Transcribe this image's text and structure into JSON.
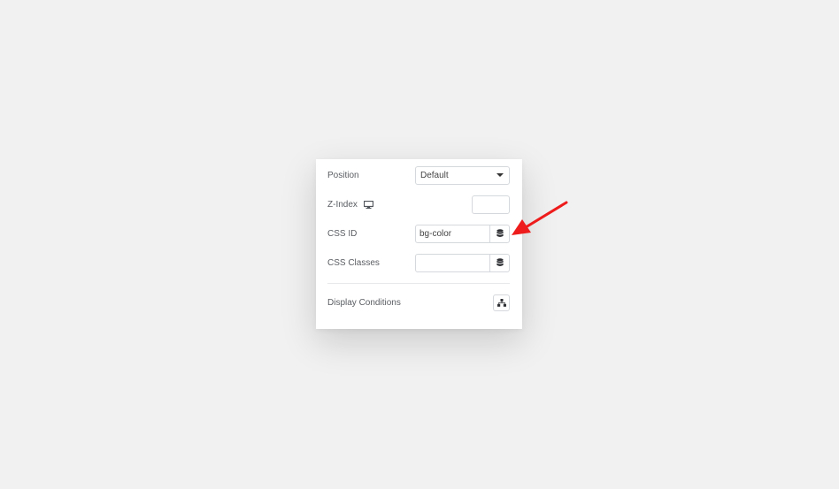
{
  "panel": {
    "position": {
      "label": "Position",
      "selected": "Default"
    },
    "zindex": {
      "label": "Z-Index",
      "value": ""
    },
    "css_id": {
      "label": "CSS ID",
      "value": "bg-color"
    },
    "css_classes": {
      "label": "CSS Classes",
      "value": ""
    },
    "display_conditions": {
      "label": "Display Conditions"
    }
  },
  "icons": {
    "desktop": "desktop-icon",
    "dynamic_tags": "database-icon",
    "conditions": "sitemap-icon",
    "annotation": "red-arrow"
  },
  "colors": {
    "background": "#f1f1f1",
    "panel": "#ffffff",
    "annotation_arrow": "#ee1c1c"
  }
}
